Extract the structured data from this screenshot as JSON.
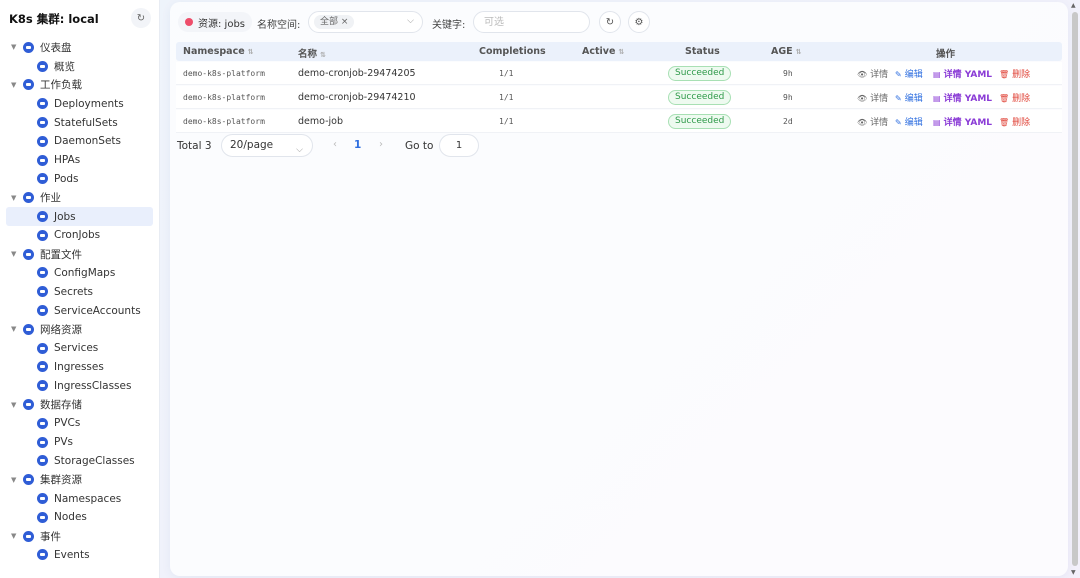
{
  "sidebar": {
    "title": "K8s 集群: local",
    "groups": [
      {
        "label": "仪表盘",
        "items": [
          "概览"
        ]
      },
      {
        "label": "工作负载",
        "items": [
          "Deployments",
          "StatefulSets",
          "DaemonSets",
          "HPAs",
          "Pods"
        ]
      },
      {
        "label": "作业",
        "items": [
          "Jobs",
          "CronJobs"
        ]
      },
      {
        "label": "配置文件",
        "items": [
          "ConfigMaps",
          "Secrets",
          "ServiceAccounts"
        ]
      },
      {
        "label": "网络资源",
        "items": [
          "Services",
          "Ingresses",
          "IngressClasses"
        ]
      },
      {
        "label": "数据存储",
        "items": [
          "PVCs",
          "PVs",
          "StorageClasses"
        ]
      },
      {
        "label": "集群资源",
        "items": [
          "Namespaces",
          "Nodes"
        ]
      },
      {
        "label": "事件",
        "items": [
          "Events"
        ]
      }
    ],
    "active_item": "Jobs"
  },
  "toolbar": {
    "resource_tag": "资源: jobs",
    "namespace_label": "名称空间:",
    "namespace_chip": "全部",
    "keyword_label": "关键字:",
    "keyword_placeholder": "可选"
  },
  "table": {
    "headers": {
      "namespace": "Namespace",
      "name": "名称",
      "completions": "Completions",
      "active": "Active",
      "status": "Status",
      "age": "AGE",
      "actions": "操作"
    },
    "rows": [
      {
        "namespace": "demo-k8s-platform",
        "name": "demo-cronjob-29474205",
        "completions": "1/1",
        "status": "Succeeded",
        "age": "9h"
      },
      {
        "namespace": "demo-k8s-platform",
        "name": "demo-cronjob-29474210",
        "completions": "1/1",
        "status": "Succeeded",
        "age": "9h"
      },
      {
        "namespace": "demo-k8s-platform",
        "name": "demo-job",
        "completions": "1/1",
        "status": "Succeeded",
        "age": "2d"
      }
    ],
    "actions": {
      "view": "详情",
      "edit": "编辑",
      "yaml": "详情 YAML",
      "delete": "删除"
    }
  },
  "pagination": {
    "total": "Total 3",
    "page_size": "20/page",
    "current_page": "1",
    "goto_label": "Go to",
    "goto_value": "1"
  }
}
